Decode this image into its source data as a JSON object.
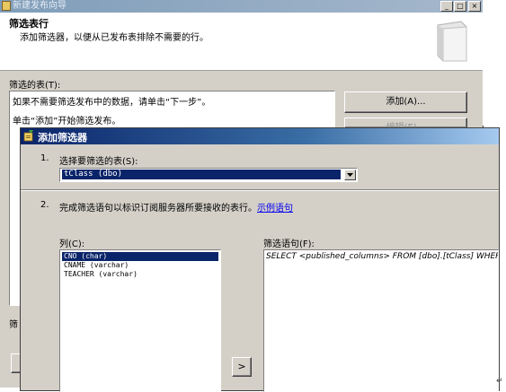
{
  "wizard": {
    "title": "新建发布向导",
    "heading": "筛选表行",
    "description": "添加筛选器，以便从已发布表排除不需要的行。",
    "tables_label": "筛选的表(T):",
    "table_lines": [
      "如果不需要筛选发布中的数据，请单击“下一步”。",
      "单击“添加”开始筛选发布。"
    ],
    "add_button": "添加(A)...",
    "edit_button": "编辑(E)...",
    "bottom_label": "筛",
    "title_buttons": [
      "_",
      "□",
      "×"
    ]
  },
  "dialog": {
    "title": "添加筛选器",
    "step1": {
      "number": "1.",
      "text": "选择要筛选的表(S):"
    },
    "selected_table": "tClass (dbo)",
    "step2": {
      "number": "2.",
      "text": "完成筛选语句以标识订阅服务器所要接收的表行。",
      "link": "示例语句"
    },
    "columns_label": "列(C):",
    "columns": [
      "CNO (char)",
      "CNAME (varchar)",
      "TEACHER (varchar)"
    ],
    "insert_button": ">",
    "statement_label": "筛选语句(F):",
    "statement": "SELECT <published_columns> FROM [dbo].[tClass] WHERE"
  },
  "return_mark": "↵"
}
